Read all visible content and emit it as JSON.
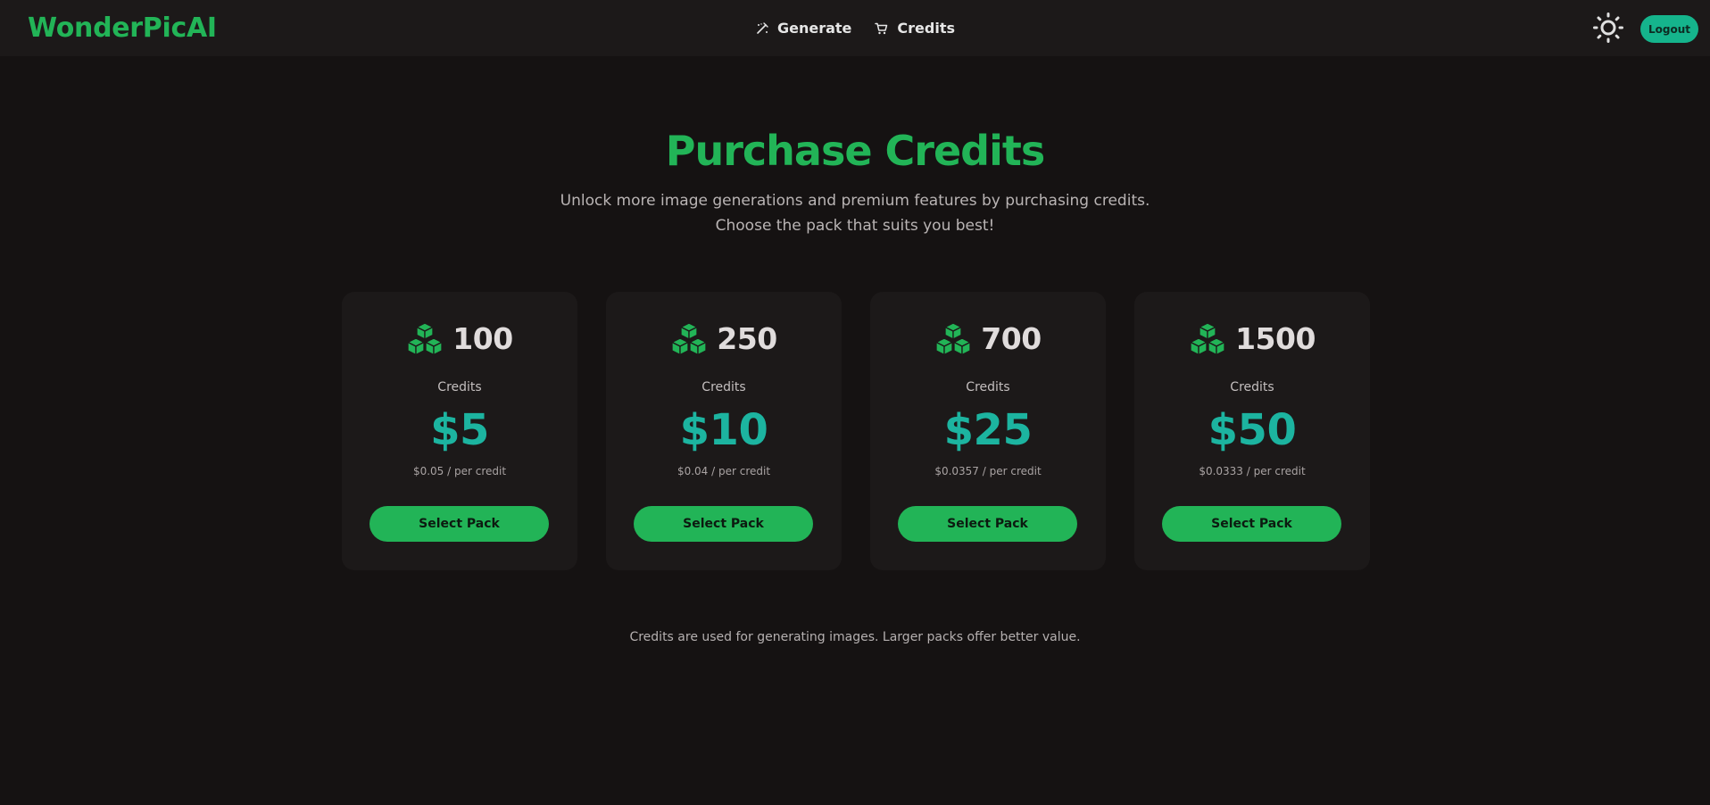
{
  "brand": {
    "name": "WonderPicAI",
    "color": "#22b457"
  },
  "nav": {
    "items": [
      {
        "label": "Generate",
        "icon": "wand-icon"
      },
      {
        "label": "Credits",
        "icon": "cart-icon"
      }
    ]
  },
  "header": {
    "theme_toggle_icon": "sun-icon",
    "logout_label": "Logout"
  },
  "hero": {
    "title": "Purchase Credits",
    "subtitle_line1": "Unlock more image generations and premium features by purchasing credits.",
    "subtitle_line2": "Choose the pack that suits you best!"
  },
  "packs": [
    {
      "credits": "100",
      "unit": "Credits",
      "price": "$5",
      "per_credit": "$0.05 / per credit",
      "button": "Select Pack",
      "icon": "cubes-icon"
    },
    {
      "credits": "250",
      "unit": "Credits",
      "price": "$10",
      "per_credit": "$0.04 / per credit",
      "button": "Select Pack",
      "icon": "cubes-icon"
    },
    {
      "credits": "700",
      "unit": "Credits",
      "price": "$25",
      "per_credit": "$0.0357 / per credit",
      "button": "Select Pack",
      "icon": "cubes-icon"
    },
    {
      "credits": "1500",
      "unit": "Credits",
      "price": "$50",
      "per_credit": "$0.0333 / per credit",
      "button": "Select Pack",
      "icon": "cubes-icon"
    }
  ],
  "footnote": "Credits are used for generating images. Larger packs offer better value.",
  "colors": {
    "background": "#151212",
    "surface": "#1c1919",
    "accent_green": "#22b457",
    "price_teal": "#1cb4a0",
    "logout_teal": "#15b48c"
  }
}
